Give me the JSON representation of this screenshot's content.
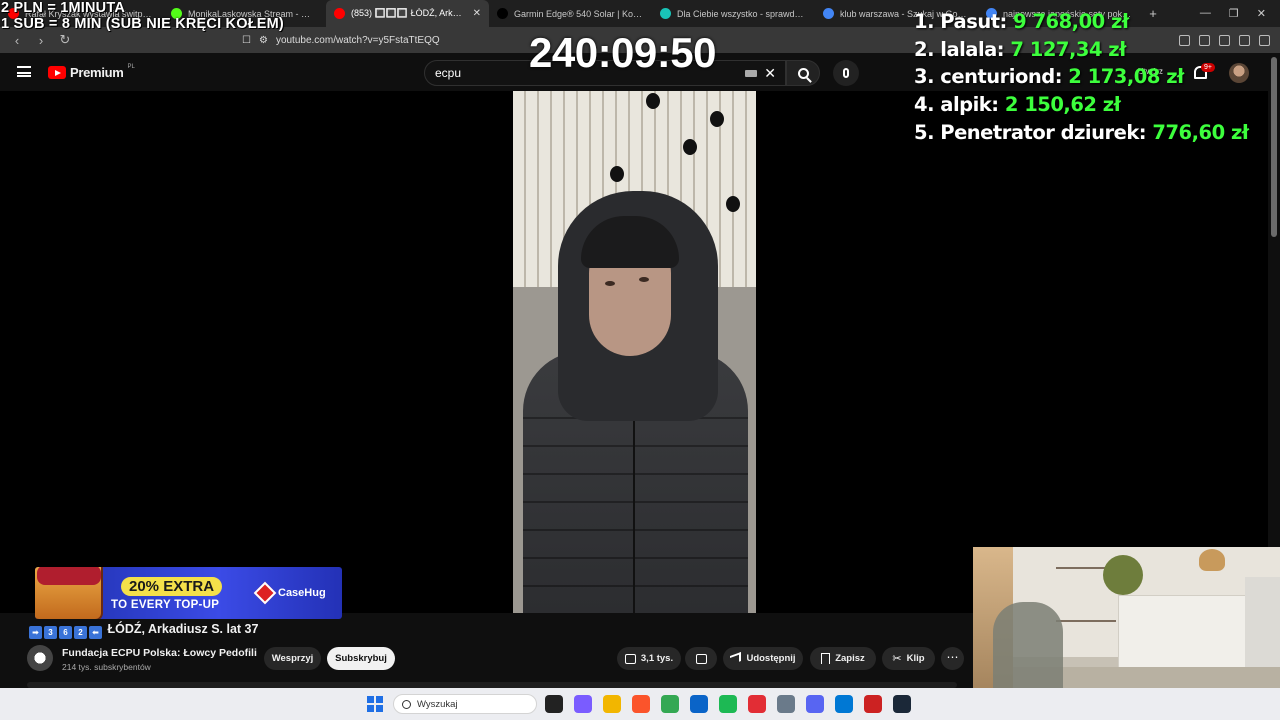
{
  "browser": {
    "tabs": [
      {
        "label": "Rafał Kryszak wystawia świtpapany",
        "favicon_color": "#ff0000"
      },
      {
        "label": "MonikaLaskowska Stream - Watch Live",
        "favicon_color": "#53fc18"
      },
      {
        "label": "(853) 🔳🔳🔳 ŁÓDŹ, Arkadiusz",
        "favicon_color": "#ff0000",
        "active": true
      },
      {
        "label": "Garmin Edge® 540 Solar | Komputer",
        "favicon_color": "#000000"
      },
      {
        "label": "Dla Ciebie wszystko - sprawdź nowe",
        "favicon_color": "#19c3b7"
      },
      {
        "label": "klub warszawa - Szukaj w Google",
        "favicon_color": "#4285f4"
      },
      {
        "label": "najnowsze japońskie sety pokemon",
        "favicon_color": "#4285f4"
      }
    ],
    "new_tab": "+",
    "url": "youtube.com/watch?v=y5FstaTtEQQ"
  },
  "youtube": {
    "logo_text": "Premium",
    "region": "PL",
    "search_value": "ecpu",
    "create_label": "Utwórz",
    "notifications_badge": "9+"
  },
  "overlays": {
    "rate_line1": "2 PLN = 1MINUTA",
    "rate_line2": "1 SUB = 8 MIN (SUB NIE KRĘCI KOŁEM)",
    "timer": "240:09:50",
    "leaderboard": [
      {
        "rank": "1.",
        "name": "Pasut:",
        "amount": "9 768,00 zł"
      },
      {
        "rank": "2.",
        "name": "lalala:",
        "amount": "7 127,34 zł"
      },
      {
        "rank": "3.",
        "name": "centuriond:",
        "amount": "2 173,08 zł"
      },
      {
        "rank": "4.",
        "name": "alpik:",
        "amount": "2 150,62 zł"
      },
      {
        "rank": "5.",
        "name": "Penetrator dziurek:",
        "amount": "776,60 zł"
      }
    ],
    "ad": {
      "headline": "20% EXTRA",
      "subline": "TO EVERY TOP-UP",
      "brand": "CaseHug"
    }
  },
  "video": {
    "title_digits": [
      "3",
      "6",
      "2"
    ],
    "title": "ŁÓDŹ, Arkadiusz S. lat 37",
    "channel_name": "Fundacja ECPU Polska: Łowcy Pedofili",
    "channel_subs": "214 tys. subskrybentów",
    "support_label": "Wesprzyj",
    "subscribe_label": "Subskrybuj",
    "likes": "3,1 tys.",
    "share_label": "Udostępnij",
    "save_label": "Zapisz",
    "clip_label": "Klip"
  },
  "taskbar": {
    "search_placeholder": "Wyszukaj",
    "app_icon_colors": [
      "#222222",
      "#7a5cff",
      "#f2b600",
      "#fb542b",
      "#34a853",
      "#0a64c8",
      "#1db954",
      "#e22d35",
      "#6a7a8a",
      "#5865f2",
      "#0078d4",
      "#cc2222",
      "#1b2838"
    ]
  }
}
